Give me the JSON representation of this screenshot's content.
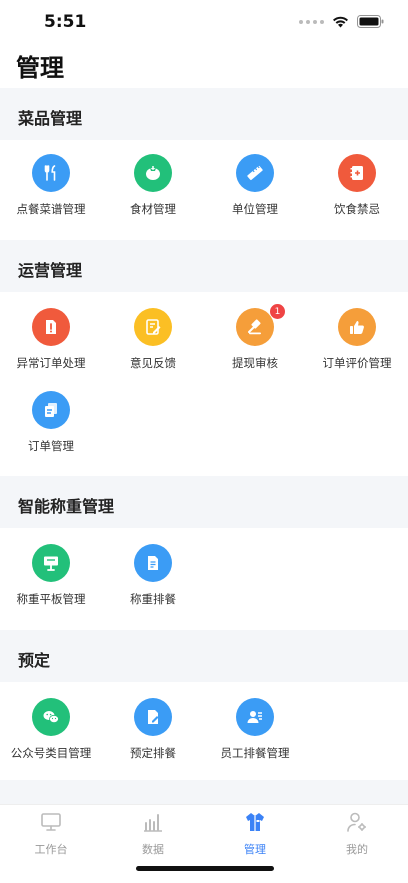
{
  "status": {
    "time": "5:51"
  },
  "page_title": "管理",
  "sections": {
    "dishes": {
      "title": "菜品管理",
      "items": [
        {
          "label": "点餐菜谱管理",
          "icon": "fork-knife-icon",
          "color": "#3b9cf5"
        },
        {
          "label": "食材管理",
          "icon": "tomato-icon",
          "color": "#22c07a"
        },
        {
          "label": "单位管理",
          "icon": "ruler-icon",
          "color": "#3b9cf5"
        },
        {
          "label": "饮食禁忌",
          "icon": "notebook-plus-icon",
          "color": "#f05a3c"
        }
      ]
    },
    "operations": {
      "title": "运营管理",
      "items": [
        {
          "label": "异常订单处理",
          "icon": "warning-doc-icon",
          "color": "#f05a3c"
        },
        {
          "label": "意见反馈",
          "icon": "edit-doc-icon",
          "color": "#fbbf24"
        },
        {
          "label": "提现审核",
          "icon": "gavel-icon",
          "color": "#f59e3a",
          "badge": "1"
        },
        {
          "label": "订单评价管理",
          "icon": "thumbs-up-icon",
          "color": "#f59e3a"
        },
        {
          "label": "订单管理",
          "icon": "copy-doc-icon",
          "color": "#3b9cf5"
        }
      ]
    },
    "weighing": {
      "title": "智能称重管理",
      "items": [
        {
          "label": "称重平板管理",
          "icon": "board-icon",
          "color": "#22c07a"
        },
        {
          "label": "称重排餐",
          "icon": "doc-lines-icon",
          "color": "#3b9cf5"
        }
      ]
    },
    "booking": {
      "title": "预定",
      "items": [
        {
          "label": "公众号类目管理",
          "icon": "wechat-icon",
          "color": "#22c07a"
        },
        {
          "label": "预定排餐",
          "icon": "doc-pen-icon",
          "color": "#3b9cf5"
        },
        {
          "label": "员工排餐管理",
          "icon": "person-list-icon",
          "color": "#3b9cf5"
        }
      ]
    }
  },
  "tabs": [
    {
      "label": "工作台",
      "icon": "monitor-icon"
    },
    {
      "label": "数据",
      "icon": "bar-chart-icon"
    },
    {
      "label": "管理",
      "icon": "shirt-icon",
      "active": true
    },
    {
      "label": "我的",
      "icon": "user-gear-icon"
    }
  ],
  "colors": {
    "accent": "#3b82f6",
    "section_bg": "#f4f6f9",
    "badge": "#ef4444"
  }
}
